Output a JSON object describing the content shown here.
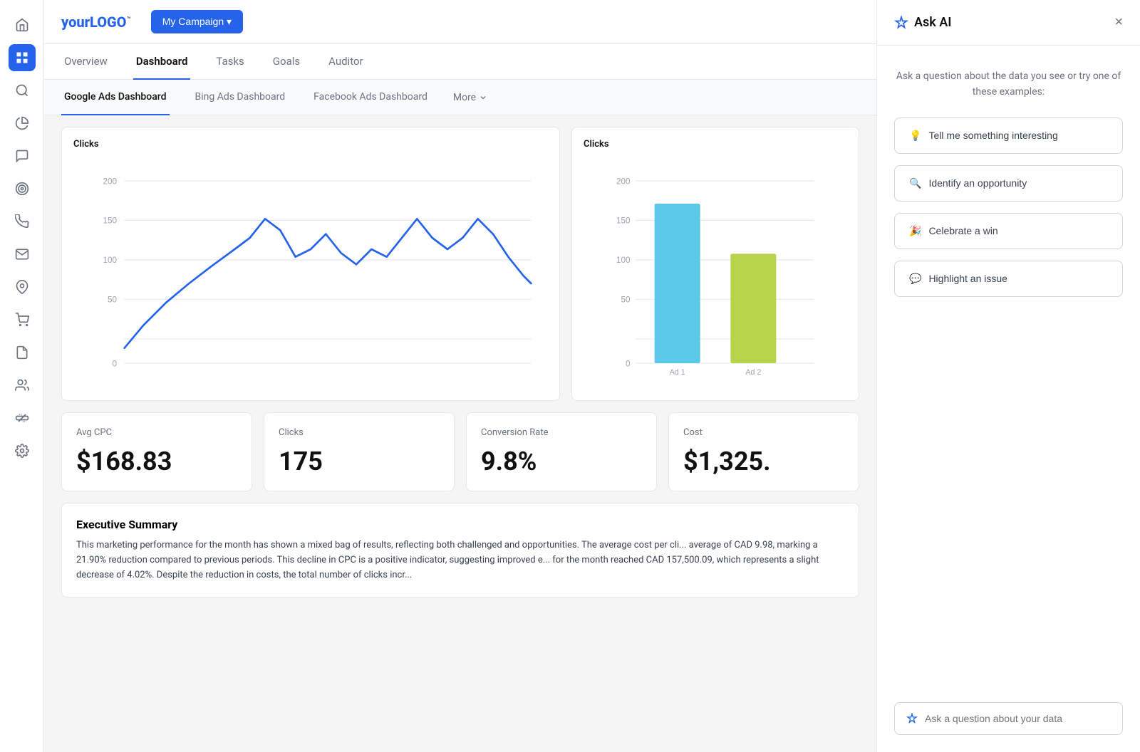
{
  "logo": {
    "text_plain": "your",
    "text_bold": "LOGO",
    "tm": "™"
  },
  "campaign_button": "My Campaign ▾",
  "nav": {
    "tabs": [
      {
        "label": "Overview",
        "active": false
      },
      {
        "label": "Dashboard",
        "active": true
      },
      {
        "label": "Tasks",
        "active": false
      },
      {
        "label": "Goals",
        "active": false
      },
      {
        "label": "Auditor",
        "active": false
      }
    ]
  },
  "sub_tabs": {
    "tabs": [
      {
        "label": "Google Ads Dashboard",
        "active": true
      },
      {
        "label": "Bing Ads Dashboard",
        "active": false
      },
      {
        "label": "Facebook Ads Dashboard",
        "active": false
      }
    ],
    "more": "More"
  },
  "charts": {
    "line_chart": {
      "title": "Clicks",
      "y_labels": [
        "200",
        "150",
        "100",
        "50",
        "0"
      ]
    },
    "bar_chart": {
      "title": "Clicks",
      "y_labels": [
        "200",
        "150",
        "100",
        "50",
        "0"
      ],
      "bars": [
        {
          "label": "Ad 1",
          "value": 175,
          "color": "#5bc8e8"
        },
        {
          "label": "Ad 2",
          "value": 120,
          "color": "#b8d44a"
        }
      ]
    }
  },
  "metrics": [
    {
      "label": "Avg CPC",
      "value": "$168.83"
    },
    {
      "label": "Clicks",
      "value": "175"
    },
    {
      "label": "Conversion Rate",
      "value": "9.8%"
    },
    {
      "label": "Cost",
      "value": "$1,325."
    }
  ],
  "executive_summary": {
    "title": "Executive Summary",
    "text": "This marketing performance for the month has shown a mixed bag of results, reflecting both challenged and opportunities. The average cost per cli... average of CAD 9.98, marking a 21.90% reduction compared to previous periods. This decline in CPC is a positive indicator, suggesting improved e... for the month reached CAD 157,500.09, which represents a slight decrease of 4.02%. Despite the reduction in costs, the total number of clicks incr..."
  },
  "ai_panel": {
    "title": "Ask AI",
    "subtitle": "Ask a question about the data you see or try one of these examples:",
    "close_label": "×",
    "suggestions": [
      {
        "label": "Tell me something interesting",
        "icon": "💡"
      },
      {
        "label": "Identify an opportunity",
        "icon": "🔍"
      },
      {
        "label": "Celebrate a win",
        "icon": "🎉"
      },
      {
        "label": "Highlight an issue",
        "icon": "💬"
      }
    ],
    "input_placeholder": "Ask a question about your data"
  },
  "sidebar_icons": [
    {
      "name": "home-icon",
      "glyph": "⊞"
    },
    {
      "name": "grid-icon",
      "glyph": "▦"
    },
    {
      "name": "search-icon",
      "glyph": "🔍"
    },
    {
      "name": "chart-icon",
      "glyph": "◎"
    },
    {
      "name": "chat-icon",
      "glyph": "💬"
    },
    {
      "name": "target-icon",
      "glyph": "◉"
    },
    {
      "name": "phone-icon",
      "glyph": "📞"
    },
    {
      "name": "email-icon",
      "glyph": "✉"
    },
    {
      "name": "location-icon",
      "glyph": "📍"
    },
    {
      "name": "cart-icon",
      "glyph": "🛒"
    },
    {
      "name": "doc-icon",
      "glyph": "📄"
    },
    {
      "name": "people-icon",
      "glyph": "👥"
    },
    {
      "name": "plug-icon",
      "glyph": "🔌"
    },
    {
      "name": "settings-icon",
      "glyph": "⚙"
    }
  ]
}
